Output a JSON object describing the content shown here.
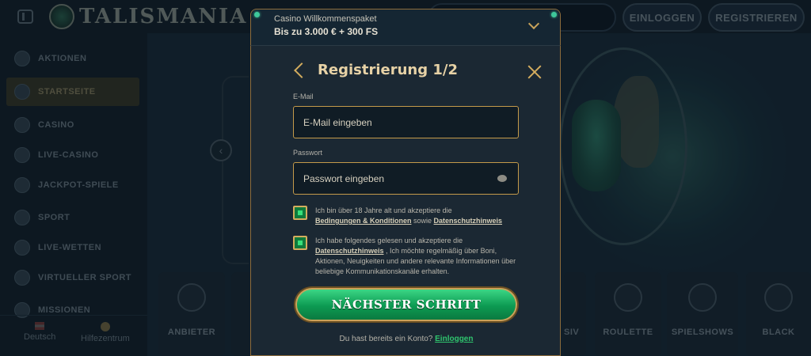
{
  "brand": {
    "name": "TALISMANIA"
  },
  "header": {
    "login_label": "EINLOGGEN",
    "register_label": "REGISTRIEREN"
  },
  "sidebar": {
    "items": [
      {
        "label": "AKTIONEN",
        "icon": "gift-icon"
      },
      {
        "label": "STARTSEITE",
        "icon": "pyramid-icon",
        "active": true
      },
      {
        "label": "CASINO",
        "icon": "chip-icon"
      },
      {
        "label": "LIVE-CASINO",
        "icon": "spade-icon"
      },
      {
        "label": "JACKPOT-SPIELE",
        "icon": "puzzle-icon"
      },
      {
        "label": "SPORT",
        "icon": "ball-icon"
      },
      {
        "label": "LIVE-WETTEN",
        "icon": "play-icon"
      },
      {
        "label": "VIRTUELLER SPORT",
        "icon": "gamepad-icon"
      },
      {
        "label": "MISSIONEN",
        "icon": "target-icon"
      }
    ],
    "footer": {
      "language": "Deutsch",
      "help": "Hilfezentrum"
    }
  },
  "categories": [
    {
      "label": "ANBIETER"
    },
    {
      "label": "SIV"
    },
    {
      "label": "ROULETTE"
    },
    {
      "label": "SPIELSHOWS"
    },
    {
      "label": "BLACK"
    }
  ],
  "bonus": {
    "title": "Casino Willkommenspaket",
    "subtitle": "Bis zu 3.000 € + 300 FS"
  },
  "modal": {
    "title": "Registrierung 1/2",
    "email": {
      "label": "E-Mail",
      "placeholder": "E-Mail eingeben",
      "value": ""
    },
    "password": {
      "label": "Passwort",
      "placeholder": "Passwort eingeben",
      "value": ""
    },
    "consent_terms": {
      "text_before": "Ich bin über 18 Jahre alt und akzeptiere die",
      "link1": "Bedingungen & Konditionen",
      "connector": "sowie",
      "link2": "Datenschutzhinweis",
      "checked": true
    },
    "consent_marketing": {
      "text_before": "Ich habe folgendes gelesen und akzeptiere die",
      "link": "Datenschutzhinweis",
      "text_after": ", Ich möchte regelmäßig über Boni, Aktionen, Neuigkeiten und andere relevante Informationen über beliebige Kommunikationskanäle erhalten.",
      "checked": true
    },
    "next_label": "NÄCHSTER SCHRITT",
    "footer_prompt": "Du hast bereits ein Konto?",
    "footer_link": "Einloggen"
  },
  "colors": {
    "accent_gold": "#d4ad5e",
    "cta_green": "#0c9a52",
    "link_green": "#2fc56e"
  }
}
